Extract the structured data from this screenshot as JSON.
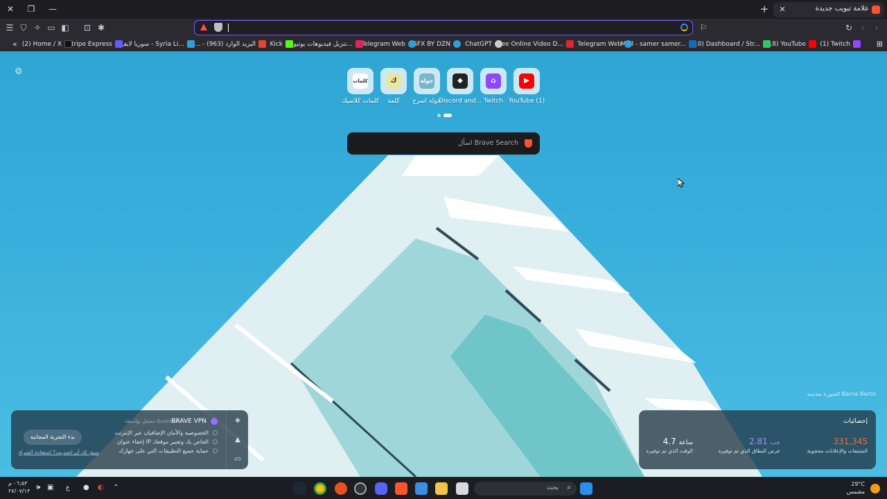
{
  "window": {
    "tab_title": "علامة تبويب جديدة"
  },
  "toolbar": {
    "url_value": ""
  },
  "bookmarks": [
    {
      "label": "(1) Twitch",
      "color": "#9146ff"
    },
    {
      "label": "(18) YouTube",
      "color": "#ff0000"
    },
    {
      "label": "(10) Dashboard / Str...",
      "color": "#2cc96b"
    },
    {
      "label": "Mail - samer samer...",
      "color": "#0f6cbd"
    },
    {
      "label": "Telegram Web",
      "color": "#2aa1da"
    },
    {
      "label": "Free Online Video D...",
      "color": "#e2233a"
    },
    {
      "label": "ChatGPT",
      "color": "#cccccc"
    },
    {
      "label": "SFX BY DZN",
      "color": "#2aa1da"
    },
    {
      "label": "Telegram Web",
      "color": "#2aa1da"
    },
    {
      "label": "تنزيل فيديوهات يوتيو...",
      "color": "#e0245e"
    },
    {
      "label": "Kick",
      "color": "#53fc18"
    },
    {
      "label": "البريد الوارد (963) - ...ه",
      "color": "#ea4335"
    },
    {
      "label": "سوريا لايف - Syria Li...",
      "color": "#2aa1da"
    },
    {
      "label": "Stripe Express",
      "color": "#635bff"
    },
    {
      "label": "(2) Home / X",
      "color": "#111111"
    }
  ],
  "top_sites": [
    {
      "label": "YouTube (1)",
      "icon": "youtube-icon",
      "color": "#ff0000",
      "glyph": "▶"
    },
    {
      "label": "Twitch",
      "icon": "twitch-icon",
      "color": "#9146ff",
      "glyph": "⌂"
    },
    {
      "label": "Discord and...",
      "icon": "discord-icon",
      "color": "#222222",
      "glyph": "◆"
    },
    {
      "label": "جولة اسرع",
      "icon": "jawla-icon",
      "color": "#7ab6c8",
      "glyph": "جولة"
    },
    {
      "label": "كلمة",
      "icon": "kelma-icon",
      "color": "#e9e6a0",
      "glyph": "ك"
    },
    {
      "label": "كلمات كلاسيك",
      "icon": "kalemat-icon",
      "color": "#ffffff",
      "glyph": "كلمات"
    }
  ],
  "search": {
    "placeholder": "اسأل Brave Search"
  },
  "photo_credit": "الصورة بعدسة Barna Bartis",
  "vpn_widget": {
    "title": "BRAVE VPN",
    "powered_by": "مشغل بواسطة Guardian",
    "features": [
      "الخصوصية والأمان الإضافيان عبر الإنترنت",
      "إخفاء عنوان IP الخاص بك وتغيير موقعك",
      "حماية جميع التطبيقات التي على جهازك"
    ],
    "cta_button": "بدء التجربة المجانية",
    "restore_link": "سبق لك أن اشتريت؟ استعادة الشراء"
  },
  "stats_widget": {
    "title": "إحصائيات",
    "items": [
      {
        "value": "331,345",
        "unit": "",
        "label": "المتتبعات والإعلانات محجوبة",
        "color": "#f26d3d"
      },
      {
        "value": "2.81",
        "unit": "جب",
        "label": "عرض النطاق الذي تم توفيره",
        "color": "#a890ff"
      },
      {
        "value": "4.7",
        "unit": "ساعة",
        "label": "الوقت الذي تم توفيره",
        "color": "#ffffff"
      }
    ]
  },
  "taskbar": {
    "search_placeholder": "بحث",
    "time": "٠٦:٥٣ م",
    "date": "٢٧/٠٧/١٣",
    "weather_temp": "29°C",
    "weather_text": "مشمس",
    "input_lang": "ع"
  }
}
